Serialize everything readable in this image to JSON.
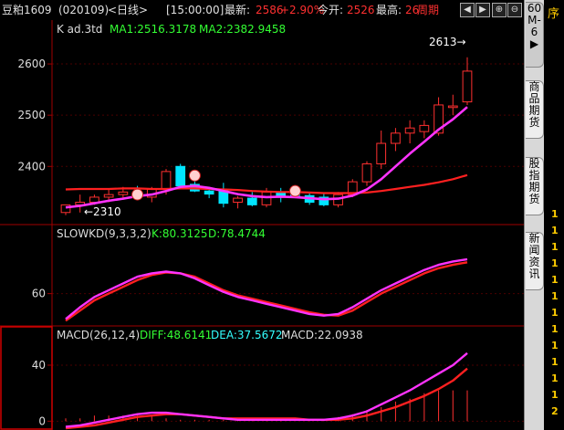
{
  "header": {
    "instrument": "豆粕1609",
    "code": "(020109)",
    "period": "<日线>",
    "time": "[15:00:00]",
    "latest_label": "最新:",
    "latest_value": "2586",
    "change_pct": "+2.90%",
    "open_label": "今开:",
    "open_value": "2526",
    "high_label": "最高:",
    "high_value": "26",
    "cycle_label": "周期",
    "btn_left": "◀",
    "btn_right": "▶",
    "btn_up": "⊕",
    "btn_down": "⊖"
  },
  "side_tabs": {
    "tab1": [
      "60",
      "M-",
      "6",
      "▶"
    ],
    "tab2": [
      "商",
      "品",
      "期",
      "货"
    ],
    "tab3": [
      "股",
      "指",
      "期",
      "货"
    ],
    "tab4": [
      "新",
      "闻",
      "资",
      "讯"
    ]
  },
  "right_strip": {
    "title": "序",
    "digits": [
      "1",
      "1",
      "1",
      "1",
      "1",
      "1",
      "1",
      "1",
      "1",
      "1",
      "1",
      "1",
      "2"
    ]
  },
  "chart_data": [
    {
      "type": "candlestick",
      "title": "K  ad.3td",
      "ma1_label": "MA1:2516.3178",
      "ma2_label": "MA2:2382.9458",
      "ylim": [
        2290,
        2650
      ],
      "yticks": [
        "2600",
        "2500",
        "2400"
      ],
      "ytick_values": [
        2600,
        2500,
        2400
      ],
      "annotations": [
        "2613→",
        "←2310"
      ],
      "candles": [
        {
          "o": 2310,
          "h": 2325,
          "l": 2305,
          "c": 2325
        },
        {
          "o": 2325,
          "h": 2345,
          "l": 2310,
          "c": 2330
        },
        {
          "o": 2330,
          "h": 2345,
          "l": 2325,
          "c": 2340
        },
        {
          "o": 2340,
          "h": 2355,
          "l": 2330,
          "c": 2345
        },
        {
          "o": 2345,
          "h": 2360,
          "l": 2335,
          "c": 2350
        },
        {
          "o": 2350,
          "h": 2362,
          "l": 2340,
          "c": 2342
        },
        {
          "o": 2340,
          "h": 2360,
          "l": 2330,
          "c": 2355
        },
        {
          "o": 2355,
          "h": 2395,
          "l": 2345,
          "c": 2390
        },
        {
          "o": 2400,
          "h": 2405,
          "l": 2355,
          "c": 2362
        },
        {
          "o": 2365,
          "h": 2375,
          "l": 2350,
          "c": 2352
        },
        {
          "o": 2352,
          "h": 2360,
          "l": 2338,
          "c": 2346
        },
        {
          "o": 2355,
          "h": 2368,
          "l": 2320,
          "c": 2328
        },
        {
          "o": 2330,
          "h": 2342,
          "l": 2318,
          "c": 2338
        },
        {
          "o": 2338,
          "h": 2350,
          "l": 2322,
          "c": 2325
        },
        {
          "o": 2325,
          "h": 2358,
          "l": 2320,
          "c": 2350
        },
        {
          "o": 2350,
          "h": 2358,
          "l": 2330,
          "c": 2340
        },
        {
          "o": 2345,
          "h": 2355,
          "l": 2338,
          "c": 2343
        },
        {
          "o": 2343,
          "h": 2350,
          "l": 2325,
          "c": 2330
        },
        {
          "o": 2340,
          "h": 2348,
          "l": 2322,
          "c": 2325
        },
        {
          "o": 2325,
          "h": 2350,
          "l": 2320,
          "c": 2345
        },
        {
          "o": 2345,
          "h": 2375,
          "l": 2340,
          "c": 2370
        },
        {
          "o": 2370,
          "h": 2410,
          "l": 2362,
          "c": 2405
        },
        {
          "o": 2405,
          "h": 2470,
          "l": 2395,
          "c": 2445
        },
        {
          "o": 2445,
          "h": 2475,
          "l": 2430,
          "c": 2465
        },
        {
          "o": 2465,
          "h": 2490,
          "l": 2445,
          "c": 2475
        },
        {
          "o": 2468,
          "h": 2490,
          "l": 2455,
          "c": 2480
        },
        {
          "o": 2465,
          "h": 2535,
          "l": 2460,
          "c": 2520
        },
        {
          "o": 2515,
          "h": 2540,
          "l": 2500,
          "c": 2518
        },
        {
          "o": 2526,
          "h": 2613,
          "l": 2520,
          "c": 2586
        }
      ],
      "ma1": [
        2320,
        2323,
        2328,
        2333,
        2337,
        2342,
        2345,
        2352,
        2360,
        2362,
        2358,
        2352,
        2346,
        2342,
        2340,
        2341,
        2340,
        2338,
        2336,
        2337,
        2343,
        2355,
        2375,
        2400,
        2425,
        2448,
        2472,
        2492,
        2516
      ],
      "ma2": [
        2355,
        2356,
        2356,
        2356,
        2357,
        2357,
        2356,
        2356,
        2357,
        2357,
        2356,
        2355,
        2354,
        2352,
        2351,
        2350,
        2350,
        2349,
        2348,
        2348,
        2348,
        2349,
        2352,
        2356,
        2360,
        2364,
        2369,
        2375,
        2383
      ],
      "markers": [
        "smiley",
        "smiley",
        "smiley"
      ]
    },
    {
      "type": "line",
      "title": "SLOWKD(9,3,3,2)",
      "k_label": "K:80.3125",
      "d_label": "D:78.4744",
      "ylim": [
        42,
        90
      ],
      "yticks": [
        "60"
      ],
      "ytick_values": [
        60
      ],
      "series": [
        {
          "name": "K",
          "values": [
            45,
            52,
            58,
            62,
            66,
            70,
            72,
            73,
            72,
            69,
            65,
            61,
            58,
            56,
            54,
            52,
            50,
            48,
            47,
            48,
            52,
            57,
            62,
            66,
            70,
            74,
            77,
            79,
            80.3
          ]
        },
        {
          "name": "D",
          "values": [
            44,
            50,
            56,
            60,
            64,
            68,
            71,
            72.5,
            72,
            70,
            66,
            62,
            59,
            57,
            55,
            53,
            51,
            49,
            47.5,
            47,
            50,
            55,
            60,
            64,
            68,
            72,
            75,
            77,
            78.5
          ]
        }
      ]
    },
    {
      "type": "line",
      "title": "MACD(26,12,4)",
      "diff_label": "DIFF:48.6141",
      "dea_label": "DEA:37.5672",
      "macd_label": "MACD:22.0938",
      "ylim": [
        -5,
        55
      ],
      "yticks": [
        "40",
        "0"
      ],
      "ytick_values": [
        40,
        0
      ],
      "series": [
        {
          "name": "DIFF",
          "values": [
            -4,
            -3,
            -1,
            1,
            3,
            5,
            6,
            6,
            5,
            4,
            3,
            2,
            1,
            1,
            1,
            1,
            1,
            1,
            1,
            2,
            4,
            7,
            12,
            17,
            22,
            28,
            34,
            40,
            48.6
          ]
        },
        {
          "name": "DEA",
          "values": [
            -5,
            -4,
            -3,
            -1,
            1,
            3,
            4,
            5,
            5,
            4,
            3,
            2,
            2,
            2,
            2,
            2,
            2,
            1,
            1,
            1,
            2,
            4,
            7,
            10,
            14,
            18,
            23,
            29,
            37.6
          ]
        }
      ],
      "histogram": [
        2,
        2,
        4,
        4,
        4,
        4,
        4,
        2,
        1,
        1,
        1,
        1,
        1,
        1,
        1,
        1,
        0,
        1,
        1,
        3,
        5,
        8,
        10,
        14,
        16,
        20,
        22,
        22,
        22
      ]
    }
  ]
}
